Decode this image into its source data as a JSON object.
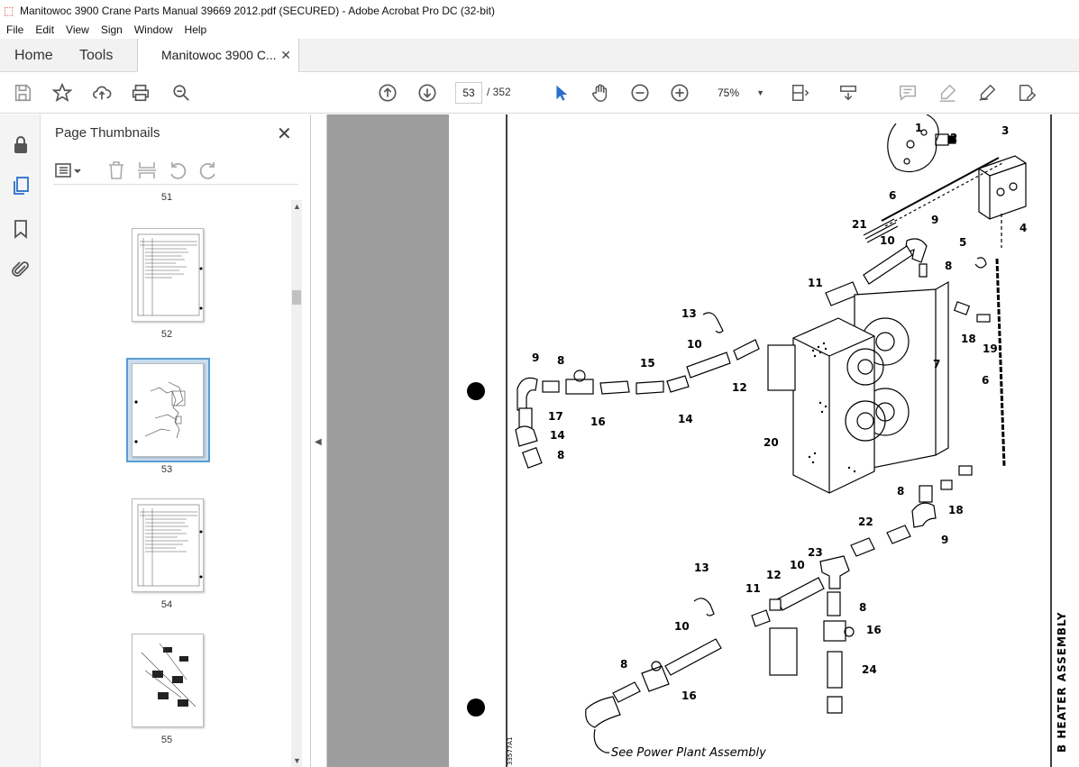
{
  "window": {
    "title": "Manitowoc 3900 Crane Parts Manual 39669 2012.pdf (SECURED) - Adobe Acrobat Pro DC (32-bit)"
  },
  "menu": [
    "File",
    "Edit",
    "View",
    "Sign",
    "Window",
    "Help"
  ],
  "tabs": {
    "home": "Home",
    "tools": "Tools",
    "document": "Manitowoc 3900 C..."
  },
  "toolbar": {
    "page_current": "53",
    "page_total": "/ 352",
    "zoom": "75%"
  },
  "panel": {
    "title": "Page Thumbnails"
  },
  "thumbnails": [
    {
      "label": "51"
    },
    {
      "label": "52"
    },
    {
      "label": "53",
      "selected": true
    },
    {
      "label": "54"
    },
    {
      "label": "55"
    }
  ],
  "drawing": {
    "callouts": [
      "1",
      "2",
      "3",
      "4",
      "5",
      "6",
      "6",
      "7",
      "8",
      "8",
      "8",
      "8",
      "8",
      "8",
      "9",
      "9",
      "9",
      "10",
      "10",
      "10",
      "10",
      "11",
      "11",
      "12",
      "12",
      "13",
      "13",
      "14",
      "14",
      "15",
      "16",
      "16",
      "16",
      "17",
      "18",
      "18",
      "19",
      "20",
      "21",
      "22",
      "23",
      "24"
    ],
    "note": "See Power Plant Assembly",
    "side_title": "B HEATER ASSEMBLY",
    "drawing_code": "33577A1"
  },
  "colors": {
    "accent": "#5b9bd5",
    "gray_canvas": "#9d9d9d",
    "pdf_red": "#d9261c"
  }
}
